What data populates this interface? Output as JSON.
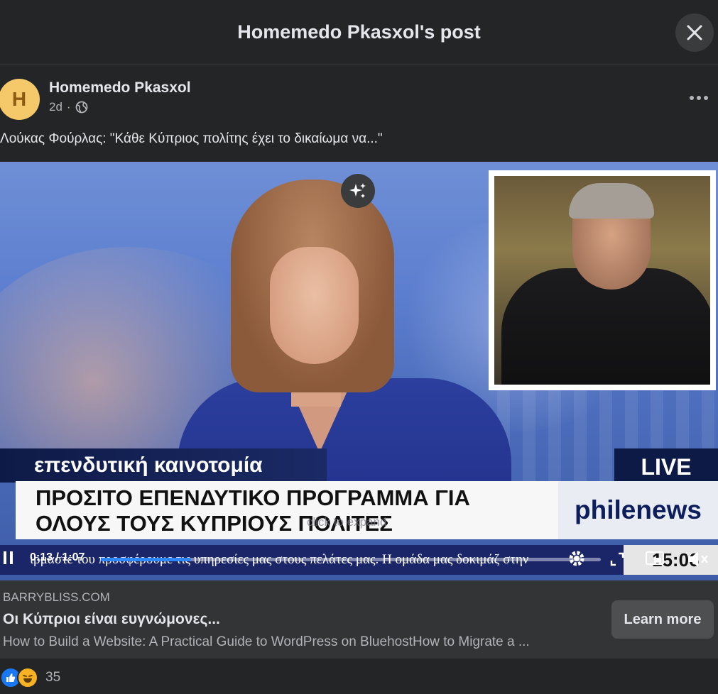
{
  "dialog": {
    "title": "Homemedo Pkasxol's post"
  },
  "post": {
    "avatar_letter": "H",
    "author": "Homemedo Pkasxol",
    "time": "2d",
    "separator": "·",
    "text": "Λούκας Φούρλας: \"Κάθε Κύπριος πολίτης έχει το δικαίωμα να...\""
  },
  "video": {
    "topic_tab": "επενδυτική καινοτομία",
    "live_label": "LIVE",
    "headline_line1": "ΠΡΟΣΙΤΟ ΕΠΕΝΔΥΤΙΚΟ ΠΡΟΓΡΑΜΜΑ ΓΙΑ",
    "headline_line2": "ΟΛΟΥΣ ΤΟΥΣ ΚΥΠΡΙΟΥΣ ΠΟΛΙΤΕΣ",
    "brand": "philenews",
    "tap_hint": "click to expand",
    "ticker": "ιρμάστε του προσφέρουμε τις υπηρεσίες μας στους πελάτες μας. Η ομάδα μας δοκιμάζ στην",
    "clock": "15:06",
    "time_current": "0:13",
    "time_separator": "/",
    "time_total": "1:07",
    "progress": 0.18
  },
  "link": {
    "domain": "BARRYBLISS.COM",
    "title": "Οι Κύπριοι είναι ευγνώμονες...",
    "description": "How to Build a Website: A Practical Guide to WordPress on BluehostHow to Migrate a ...",
    "cta": "Learn more"
  },
  "reactions": {
    "count": "35",
    "types": [
      "like-icon",
      "haha-icon"
    ]
  },
  "colors": {
    "background": "#242526",
    "accent": "#1877f2",
    "link_bg": "#323436",
    "news_navy": "#0e1a46"
  }
}
